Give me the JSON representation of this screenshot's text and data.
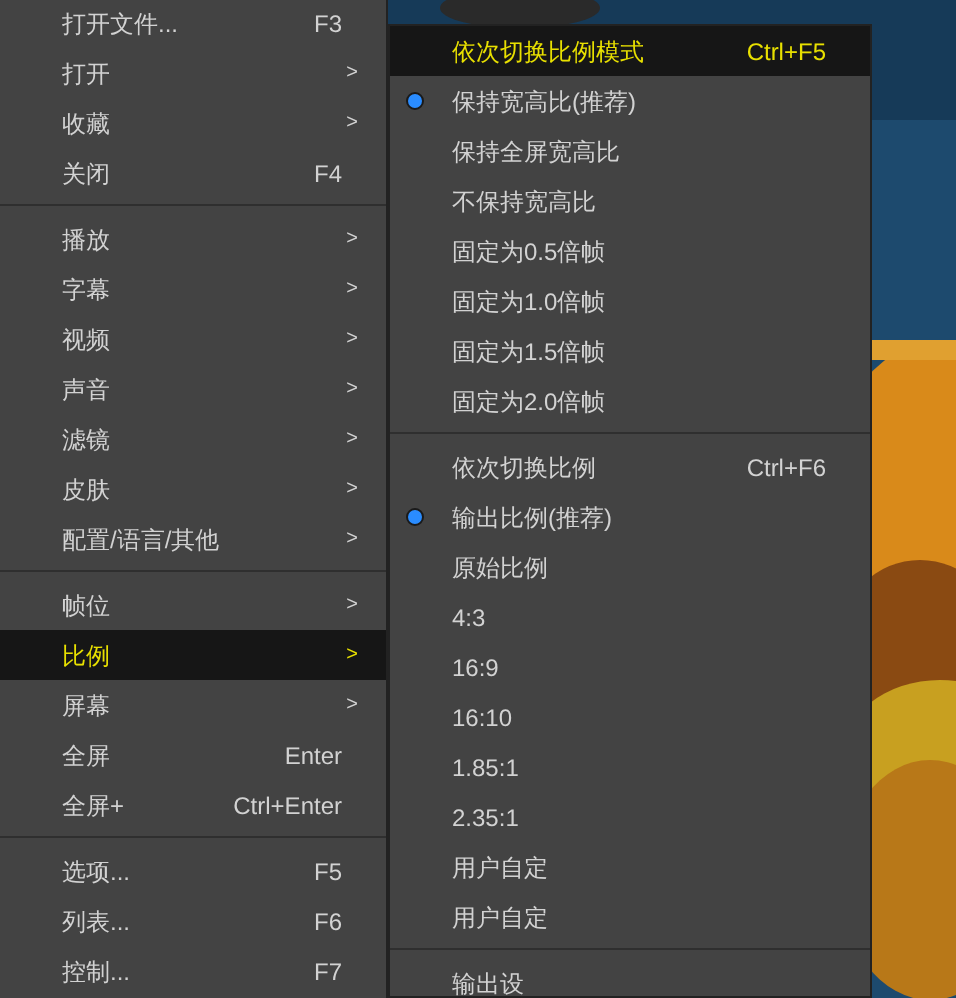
{
  "main_menu": {
    "items": [
      {
        "kind": "item",
        "label": "打开文件...",
        "shortcut": "F3",
        "selected": false
      },
      {
        "kind": "item",
        "label": "打开",
        "arrow": ">",
        "selected": false
      },
      {
        "kind": "item",
        "label": "收藏",
        "arrow": ">",
        "selected": false
      },
      {
        "kind": "item",
        "label": "关闭",
        "shortcut": "F4",
        "selected": false
      },
      {
        "kind": "separator"
      },
      {
        "kind": "item",
        "label": "播放",
        "arrow": ">",
        "selected": false
      },
      {
        "kind": "item",
        "label": "字幕",
        "arrow": ">",
        "selected": false
      },
      {
        "kind": "item",
        "label": "视频",
        "arrow": ">",
        "selected": false
      },
      {
        "kind": "item",
        "label": "声音",
        "arrow": ">",
        "selected": false
      },
      {
        "kind": "item",
        "label": "滤镜",
        "arrow": ">",
        "selected": false
      },
      {
        "kind": "item",
        "label": "皮肤",
        "arrow": ">",
        "selected": false
      },
      {
        "kind": "item",
        "label": "配置/语言/其他",
        "arrow": ">",
        "selected": false
      },
      {
        "kind": "separator"
      },
      {
        "kind": "item",
        "label": "帧位",
        "arrow": ">",
        "selected": false
      },
      {
        "kind": "item",
        "label": "比例",
        "arrow": ">",
        "selected": true
      },
      {
        "kind": "item",
        "label": "屏幕",
        "arrow": ">",
        "selected": false
      },
      {
        "kind": "item",
        "label": "全屏",
        "shortcut": "Enter",
        "selected": false
      },
      {
        "kind": "item",
        "label": "全屏+",
        "shortcut": "Ctrl+Enter",
        "selected": false
      },
      {
        "kind": "separator"
      },
      {
        "kind": "item",
        "label": "选项...",
        "shortcut": "F5",
        "selected": false
      },
      {
        "kind": "item",
        "label": "列表...",
        "shortcut": "F6",
        "selected": false
      },
      {
        "kind": "item",
        "label": "控制...",
        "shortcut": "F7",
        "selected": false
      }
    ]
  },
  "submenu": {
    "items": [
      {
        "kind": "item",
        "label": "依次切换比例模式",
        "shortcut": "Ctrl+F5",
        "checked": false,
        "selected": true
      },
      {
        "kind": "item",
        "label": "保持宽高比(推荐)",
        "checked": true,
        "selected": false
      },
      {
        "kind": "item",
        "label": "保持全屏宽高比",
        "checked": false,
        "selected": false
      },
      {
        "kind": "item",
        "label": "不保持宽高比",
        "checked": false,
        "selected": false
      },
      {
        "kind": "item",
        "label": "固定为0.5倍帧",
        "checked": false,
        "selected": false
      },
      {
        "kind": "item",
        "label": "固定为1.0倍帧",
        "checked": false,
        "selected": false
      },
      {
        "kind": "item",
        "label": "固定为1.5倍帧",
        "checked": false,
        "selected": false
      },
      {
        "kind": "item",
        "label": "固定为2.0倍帧",
        "checked": false,
        "selected": false
      },
      {
        "kind": "separator"
      },
      {
        "kind": "item",
        "label": "依次切换比例",
        "shortcut": "Ctrl+F6",
        "checked": false,
        "selected": false
      },
      {
        "kind": "item",
        "label": "输出比例(推荐)",
        "checked": true,
        "selected": false
      },
      {
        "kind": "item",
        "label": "原始比例",
        "checked": false,
        "selected": false
      },
      {
        "kind": "item",
        "label": "4:3",
        "checked": false,
        "selected": false
      },
      {
        "kind": "item",
        "label": "16:9",
        "checked": false,
        "selected": false
      },
      {
        "kind": "item",
        "label": "16:10",
        "checked": false,
        "selected": false
      },
      {
        "kind": "item",
        "label": "1.85:1",
        "checked": false,
        "selected": false
      },
      {
        "kind": "item",
        "label": "2.35:1",
        "checked": false,
        "selected": false
      },
      {
        "kind": "item",
        "label": "用户自定",
        "checked": false,
        "selected": false
      },
      {
        "kind": "item",
        "label": "用户自定",
        "checked": false,
        "selected": false
      },
      {
        "kind": "separator"
      },
      {
        "kind": "item",
        "label": "输出设",
        "checked": false,
        "selected": false
      }
    ]
  }
}
